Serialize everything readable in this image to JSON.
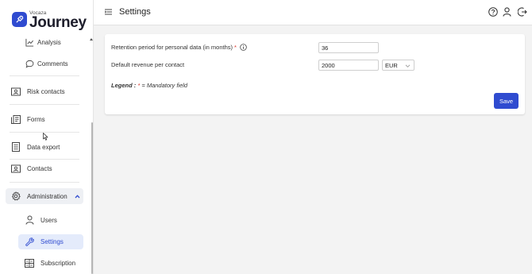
{
  "app": {
    "brand_small": "Vocaza",
    "brand_big": "Journey"
  },
  "sidebar": {
    "items": [
      {
        "label": "Analysis",
        "icon": "chart-line-icon"
      },
      {
        "label": "Comments",
        "icon": "comment-icon"
      },
      {
        "label": "Risk contacts",
        "icon": "contact-card-icon"
      },
      {
        "label": "Forms",
        "icon": "forms-icon"
      },
      {
        "label": "Data export",
        "icon": "document-icon"
      },
      {
        "label": "Contacts",
        "icon": "contact-card-icon"
      },
      {
        "label": "Administration",
        "icon": "gear-icon"
      },
      {
        "label": "Users",
        "icon": "user-icon"
      },
      {
        "label": "Settings",
        "icon": "wrench-icon"
      },
      {
        "label": "Subscription",
        "icon": "subscription-icon"
      }
    ]
  },
  "header": {
    "title": "Settings"
  },
  "form": {
    "retention_label": "Retention period for personal data (in months)",
    "required_mark": "*",
    "retention_value": "36",
    "revenue_label": "Default revenue per contact",
    "revenue_value": "2000",
    "currency": "EUR",
    "legend_label": "Legend :",
    "legend_star": "*",
    "legend_text": "= Mandatory field",
    "save_label": "Save"
  },
  "colors": {
    "accent": "#2f4bd0",
    "required": "#d93025",
    "active_bg": "#e4ebfb"
  }
}
